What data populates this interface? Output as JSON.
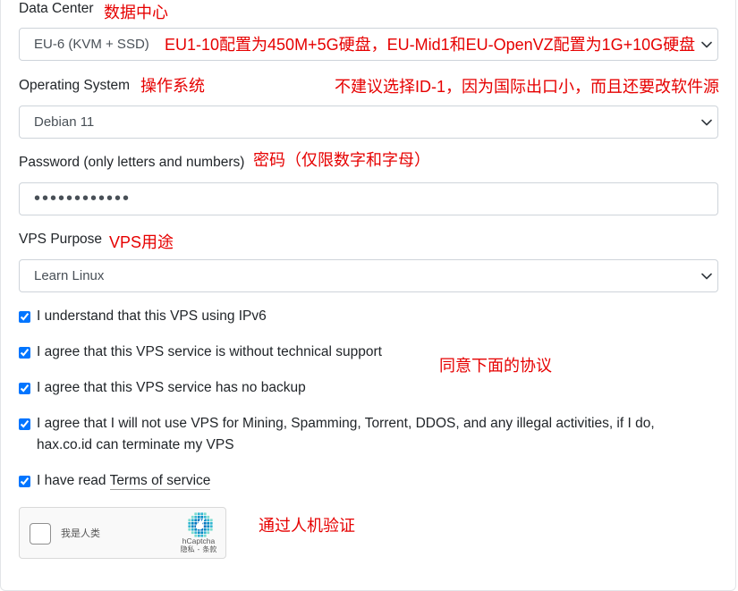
{
  "colors": {
    "annotation": "#e60000",
    "checkbox_accent": "#0075ff",
    "text": "#212529"
  },
  "icons": {
    "select_arrow": "chevron-down-icon",
    "captcha_logo": "hcaptcha-logo-icon"
  },
  "form": {
    "data_center": {
      "label": "Data Center",
      "note": "数据中心",
      "selected": "EU-6 (KVM + SSD)",
      "selected_note": "EU1-10配置为450M+5G硬盘，EU-Mid1和EU-OpenVZ配置为1G+10G硬盘"
    },
    "operating_system": {
      "label": "Operating System",
      "note": "操作系统",
      "warning": "不建议选择ID-1，因为国际出口小，而且还要改软件源",
      "selected": "Debian 11"
    },
    "password": {
      "label": "Password (only letters and numbers)",
      "note": "密码（仅限数字和字母）",
      "masked_value": "••••••••••••"
    },
    "vps_purpose": {
      "label": "VPS Purpose",
      "note": "VPS用途",
      "selected": "Learn Linux"
    },
    "agreements": {
      "note": "同意下面的协议",
      "items": [
        {
          "text": "I understand that this VPS using IPv6",
          "checked": true
        },
        {
          "text": "I agree that this VPS service is without technical support",
          "checked": true
        },
        {
          "text": "I agree that this VPS service has no backup",
          "checked": true
        },
        {
          "text": "I agree that I will not use VPS for Mining, Spamming, Torrent, DDOS, and any illegal activities, if I do, hax.co.id can terminate my VPS",
          "checked": true
        }
      ],
      "terms": {
        "prefix": "I have read",
        "link": "Terms of service",
        "checked": true
      }
    },
    "captcha": {
      "note": "通过人机验证",
      "checkbox_label": "我是人类",
      "checked": false,
      "brand": "hCaptcha",
      "privacy_link": "隐私",
      "separator": "-",
      "terms_link": "条款"
    }
  }
}
